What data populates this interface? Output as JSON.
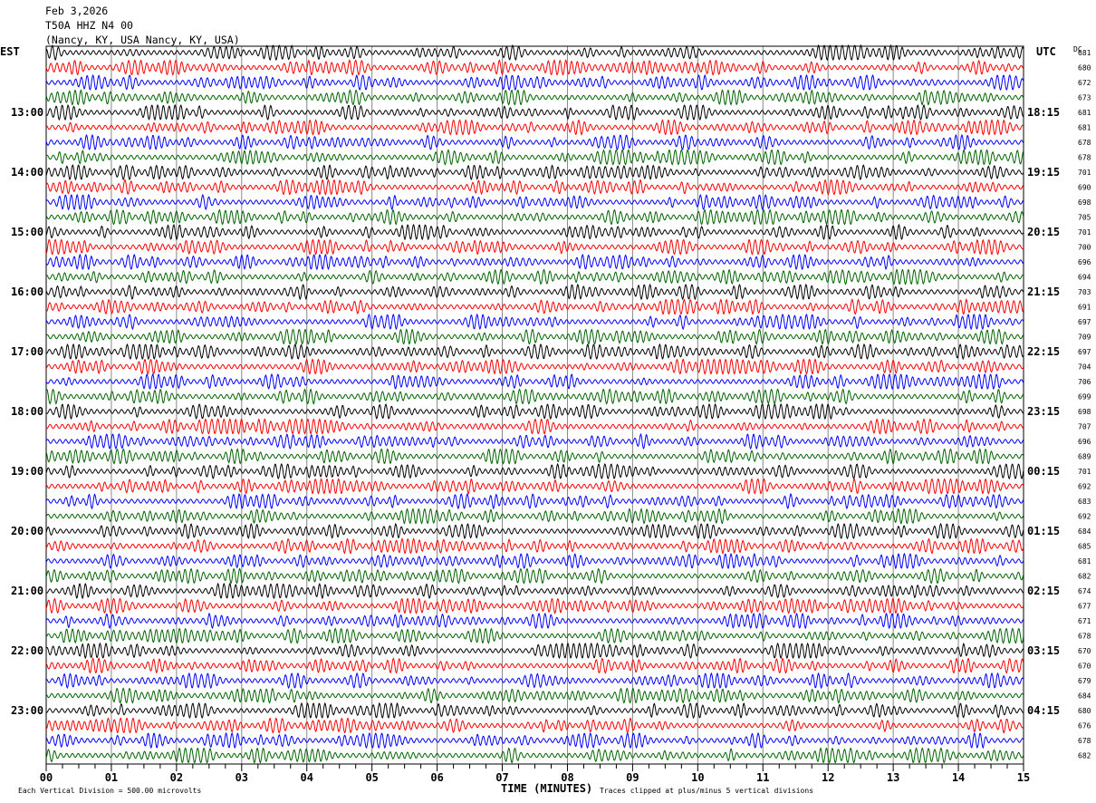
{
  "chart_data": {
    "type": "line",
    "subtype": "helicorder",
    "title_lines": [
      "Feb 3,2026",
      "T50A HHZ N4 00",
      "(Nancy, KY, USA Nancy, KY, USA)"
    ],
    "left_axis_label": "EST",
    "right_axis_label": "UTC",
    "dc_label": "DC",
    "xlabel": "TIME (MINUTES)",
    "xlim": [
      0,
      15
    ],
    "x_ticks": [
      "00",
      "01",
      "02",
      "03",
      "04",
      "05",
      "06",
      "07",
      "08",
      "09",
      "10",
      "11",
      "12",
      "13",
      "14",
      "15"
    ],
    "est_hour_labels": [
      "",
      "13:00",
      "14:00",
      "15:00",
      "16:00",
      "17:00",
      "18:00",
      "19:00",
      "20:00",
      "21:00",
      "22:00",
      "23:00"
    ],
    "utc_hour_labels": [
      "",
      "18:15",
      "19:15",
      "20:15",
      "21:15",
      "22:15",
      "23:15",
      "00:15",
      "01:15",
      "02:15",
      "03:15",
      "04:15"
    ],
    "traces_per_hour": 4,
    "trace_colors": [
      "#000000",
      "#ff0000",
      "#0000ff",
      "#006400"
    ],
    "dc_values": [
      "681",
      "680",
      "672",
      "673",
      "681",
      "681",
      "678",
      "678",
      "701",
      "690",
      "698",
      "705",
      "701",
      "700",
      "696",
      "694",
      "703",
      "691",
      "697",
      "709",
      "697",
      "704",
      "706",
      "699",
      "698",
      "707",
      "696",
      "689",
      "701",
      "692",
      "683",
      "692",
      "684",
      "685",
      "681",
      "682",
      "674",
      "677",
      "671",
      "678",
      "670",
      "670",
      "679",
      "684",
      "680",
      "676",
      "678",
      "682"
    ],
    "footer_left": "Each Vertical Division =  500.00 microvolts",
    "footer_right": "Traces clipped at plus/minus 5 vertical divisions",
    "grid": true
  }
}
